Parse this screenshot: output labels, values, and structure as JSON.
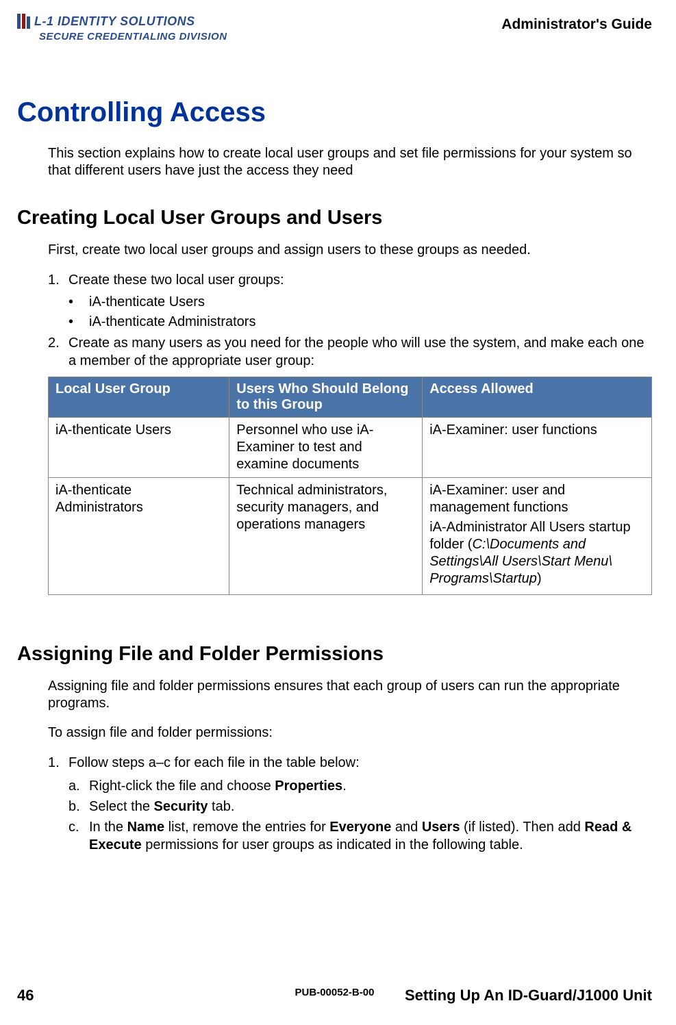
{
  "header": {
    "logo_line1": "L-1 IDENTITY SOLUTIONS",
    "logo_line2": "SECURE CREDENTIALING DIVISION",
    "guide_title": "Administrator's Guide"
  },
  "h1": "Controlling Access",
  "intro": "This section explains how to create local user groups and set file permissions for your system so that different users have just the access they need",
  "section1": {
    "title": "Creating Local User Groups and Users",
    "intro": "First, create two local user groups and assign users to these groups as needed.",
    "step1": "Create these two local user groups:",
    "bullet1": "iA-thenticate  Users",
    "bullet2": "iA-thenticate  Administrators",
    "step2": "Create as many users as you need for the people who will use the system, and make each one a member of the appropriate user group:",
    "table": {
      "headers": [
        "Local User Group",
        "Users Who Should Belong to this Group",
        "Access Allowed"
      ],
      "row1": {
        "c1": "iA-thenticate Users",
        "c2": "Personnel who use iA-Examiner to test and examine documents",
        "c3": "iA-Examiner:  user functions"
      },
      "row2": {
        "c1": "iA-thenticate Administrators",
        "c2": "Technical administrators, security managers, and operations managers",
        "c3_p1": "iA-Examiner: user and management functions",
        "c3_p2_pre": "iA-Administrator All Users startup folder (",
        "c3_p2_italic": "C:\\Documents and Settings\\All Users\\Start Menu\\ Programs\\Startup",
        "c3_p2_post": ")"
      }
    }
  },
  "section2": {
    "title": "Assigning File and Folder Permissions",
    "intro": "Assigning file and folder permissions ensures that each group of users can run the appropriate programs.",
    "intro2": "To assign file and folder permissions:",
    "step1": "Follow steps a–c for each file in the table below:",
    "sub_a_pre": "Right-click the file and choose ",
    "sub_a_bold": "Properties",
    "sub_a_post": ".",
    "sub_b_pre": "Select the ",
    "sub_b_bold": "Security",
    "sub_b_post": " tab.",
    "sub_c_pre": "In the ",
    "sub_c_b1": "Name",
    "sub_c_mid1": " list, remove the entries for ",
    "sub_c_b2": "Everyone",
    "sub_c_mid2": " and ",
    "sub_c_b3": "Users",
    "sub_c_mid3": " (if listed). Then add ",
    "sub_c_b4": "Read & Execute",
    "sub_c_post": " permissions for user groups as indicated in the following table."
  },
  "footer": {
    "page": "46",
    "pub": "PUB-00052-B-00",
    "section": "Setting Up An ID-Guard/J1000 Unit"
  }
}
